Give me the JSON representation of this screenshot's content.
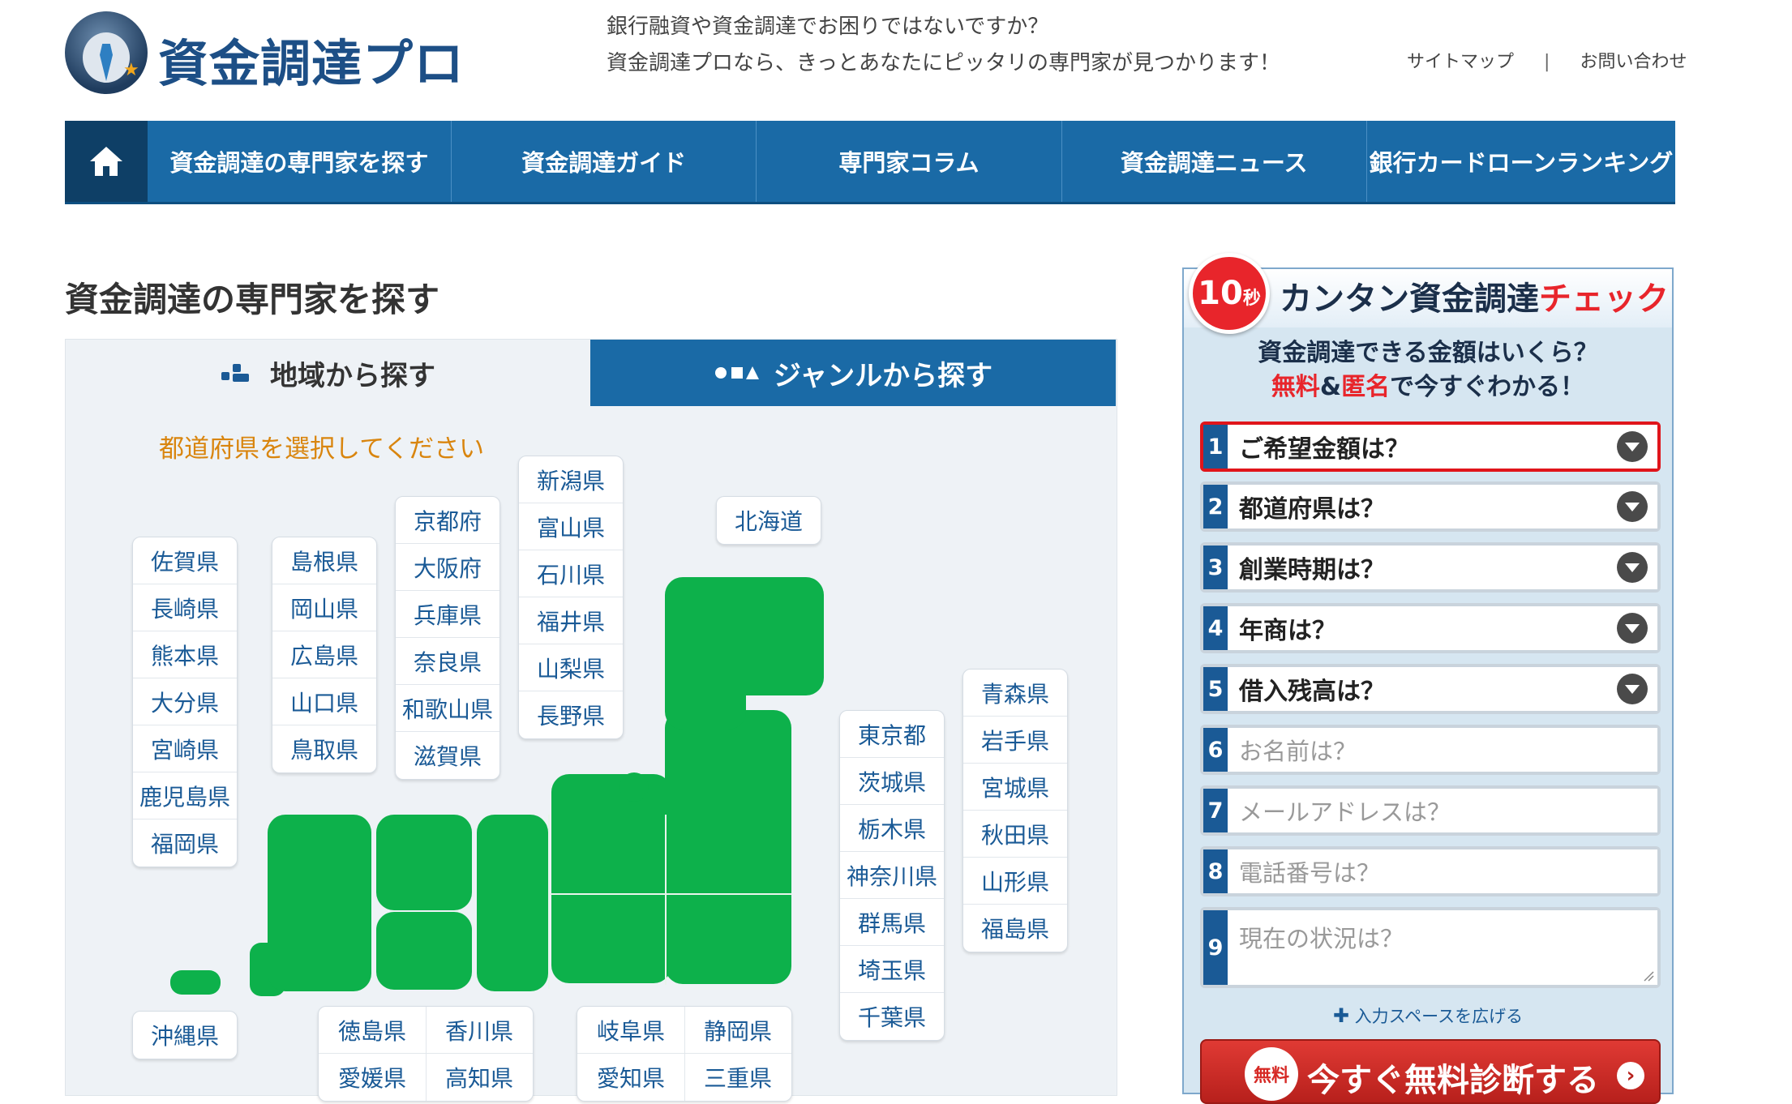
{
  "brand": {
    "logo_text": "資金調達プロ"
  },
  "header": {
    "tagline_1": "銀行融資や資金調達でお困りではないですか？",
    "tagline_2": "資金調達プロなら、きっとあなたにピッタリの専門家が見つかります！",
    "links": {
      "sitemap": "サイトマップ",
      "separator": "|",
      "contact": "お問い合わせ"
    }
  },
  "nav": {
    "home_icon": "home-icon",
    "items": [
      "資金調達の専門家を探す",
      "資金調達ガイド",
      "専門家コラム",
      "資金調達ニュース",
      "銀行カードローンランキング"
    ]
  },
  "main": {
    "title": "資金調達の専門家を探す",
    "tabs": {
      "region": "地域から探す",
      "genre": "ジャンルから探す"
    },
    "prompt": "都道府県を選択してください",
    "prefectures": {
      "kyushu": [
        "佐賀県",
        "長崎県",
        "熊本県",
        "大分県",
        "宮崎県",
        "鹿児島県",
        "福岡県"
      ],
      "chugoku": [
        "島根県",
        "岡山県",
        "広島県",
        "山口県",
        "鳥取県"
      ],
      "kinki": [
        "京都府",
        "大阪府",
        "兵庫県",
        "奈良県",
        "和歌山県",
        "滋賀県"
      ],
      "hokuriku": [
        "新潟県",
        "富山県",
        "石川県",
        "福井県",
        "山梨県",
        "長野県"
      ],
      "hokkaido": [
        "北海道"
      ],
      "kanto": [
        "東京都",
        "茨城県",
        "栃木県",
        "神奈川県",
        "群馬県",
        "埼玉県",
        "千葉県"
      ],
      "tohoku": [
        "青森県",
        "岩手県",
        "宮城県",
        "秋田県",
        "山形県",
        "福島県"
      ],
      "okinawa": [
        "沖縄県"
      ],
      "shikoku": [
        "徳島県",
        "香川県",
        "愛媛県",
        "高知県"
      ],
      "tokai": [
        "岐阜県",
        "静岡県",
        "愛知県",
        "三重県"
      ]
    },
    "map_color": "#0db14b"
  },
  "sidebar": {
    "badge_num": "10",
    "badge_unit": "秒",
    "title_main": "カンタン資金調達",
    "title_accent": "チェック",
    "sub_line1": "資金調達できる金額はいくら？",
    "sub_free": "無料",
    "sub_amp": "&",
    "sub_anon": "匿名",
    "sub_rest": "で今すぐわかる！",
    "questions": [
      {
        "num": "1",
        "label": "ご希望金額は？"
      },
      {
        "num": "2",
        "label": "都道府県は？"
      },
      {
        "num": "3",
        "label": "創業時期は？"
      },
      {
        "num": "4",
        "label": "年商は？"
      },
      {
        "num": "5",
        "label": "借入残高は？"
      }
    ],
    "inputs": [
      {
        "num": "6",
        "placeholder": "お名前は？"
      },
      {
        "num": "7",
        "placeholder": "メールアドレスは？"
      },
      {
        "num": "8",
        "placeholder": "電話番号は？"
      },
      {
        "num": "9",
        "placeholder": "現在の状況は？"
      }
    ],
    "expand_label": "入力スペースを広げる",
    "cta_badge": "無料",
    "cta_label": "今すぐ無料診断する",
    "accent_red": "#e8252b",
    "brand_blue": "#1a6aa6"
  }
}
